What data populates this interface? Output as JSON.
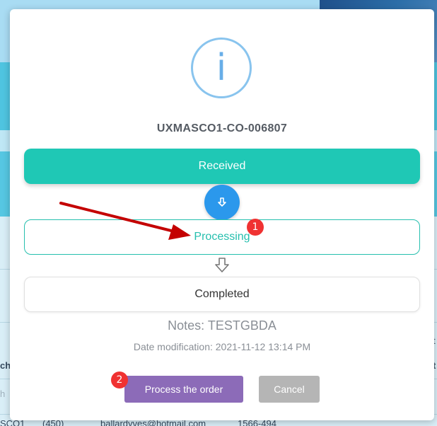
{
  "background": {
    "table_fragments": {
      "left_col_partial": "ch",
      "row_first_col": "SCO1",
      "row_area": "(450)",
      "row_email": "ballardyves@hotmail.com",
      "row_number": "1566-494",
      "right_partial_1": "t",
      "right_partial_2": "t",
      "search_partial": "h"
    }
  },
  "modal": {
    "icon": "info-icon",
    "icon_glyph": "i",
    "order_code": "UXMASCO1-CO-006807",
    "steps": [
      {
        "label": "Received",
        "state": "done"
      },
      {
        "label": "Processing",
        "state": "current"
      },
      {
        "label": "Completed",
        "state": "pending"
      }
    ],
    "notes": "Notes: TESTGBDA",
    "date_modification": "Date modification: 2021-11-12 13:14 PM",
    "buttons": {
      "process_label": "Process the order",
      "cancel_label": "Cancel"
    },
    "colors": {
      "received": "#1fc8b5",
      "processing": "#26bfae",
      "arrow_button": "#2b98ec",
      "process_button": "#8c6bb8",
      "cancel_button": "#b5b5b5"
    }
  },
  "annotations": {
    "badge_1": "1",
    "badge_2": "2",
    "arrow_color": "#c40000"
  }
}
